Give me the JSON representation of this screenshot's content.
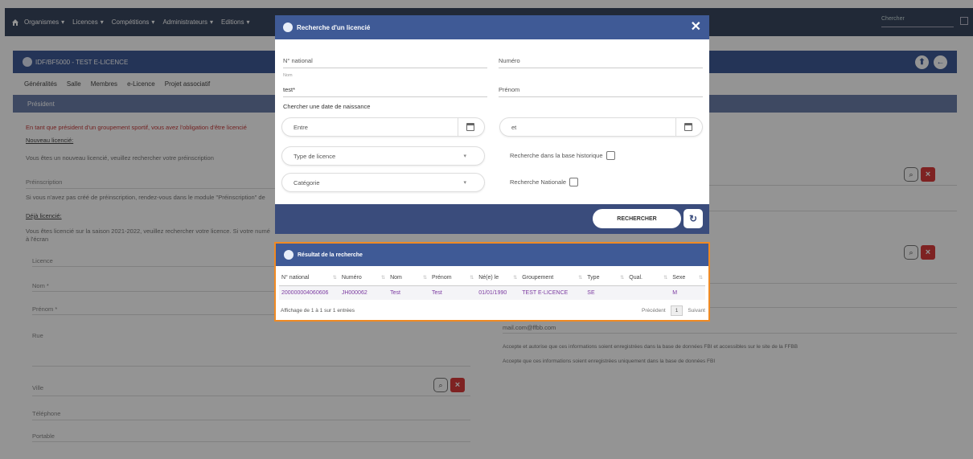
{
  "topnav": {
    "items": [
      "Organismes",
      "Licences",
      "Compétitions",
      "Administrateurs",
      "Editions"
    ],
    "search_placeholder": "Chercher"
  },
  "entity": {
    "title": "IDF/BF5000 - TEST E-LICENCE"
  },
  "tabs": [
    "Généralités",
    "Salle",
    "Membres",
    "e-Licence",
    "Projet associatif"
  ],
  "section": {
    "title": "Président"
  },
  "background": {
    "notice": "En tant que président d'un groupement sportif, vous avez l'obligation d'être licencié",
    "new_licensee_title": "Nouveau licencié:",
    "new_licensee_text": "Vous êtes un nouveau licencié, veuillez rechercher votre préinscription",
    "preinscription_label": "Préinscription",
    "preinscription_help": "Si vous n'avez pas créé de préinscription, rendez-vous dans le module \"Préinscription\" de",
    "already_title": "Déjà licencié:",
    "already_text": "Vous êtes licencié sur la saison 2021-2022, veuillez rechercher votre licence. Si votre numé",
    "already_text2": "à l'écran",
    "licence_label": "Licence",
    "nom_label": "Nom *",
    "prenom_label": "Prénom *",
    "rue_label": "Rue",
    "ville_label": "Ville",
    "telephone_label": "Téléphone",
    "portable_label": "Portable",
    "email_value": "mail.com@ffbb.com",
    "consent_1": "Accepte et autorise que ces informations soient enregistrées dans la base de données FBI et accessibles sur le site de la FFBB",
    "consent_2": "Accepte que ces informations soient enregistrées uniquement dans la base de données FBI"
  },
  "modal": {
    "title": "Recherche d'un licencié",
    "national_label": "N° national",
    "numero_label": "Numéro",
    "nom_small_label": "Nom",
    "nom_value": "test*",
    "prenom_label": "Prénom",
    "birth_title": "Chercher une date de naissance",
    "between_placeholder": "Entre",
    "and_placeholder": "et",
    "licence_type_placeholder": "Type de licence",
    "category_placeholder": "Catégorie",
    "historic_label": "Recherche dans la base historique",
    "national_search_label": "Recherche Nationale",
    "search_button": "RECHERCHER"
  },
  "results": {
    "title": "Résultat de la recherche",
    "columns": [
      "N° national",
      "Numéro",
      "Nom",
      "Prénom",
      "Né(e) le",
      "Groupement",
      "Type",
      "Qual.",
      "Sexe"
    ],
    "rows": [
      [
        "200000004060606",
        "JH000062",
        "Test",
        "Test",
        "01/01/1990",
        "TEST E-LICENCE",
        "SE",
        "",
        "M"
      ]
    ],
    "info": "Affichage de 1 à 1 sur 1 entrées",
    "prev_label": "Précédent",
    "page": "1",
    "next_label": "Suivant"
  },
  "colors": {
    "header_blue": "#3f5a96",
    "footer_blue": "#3a4c7c",
    "highlight_orange": "#f08a23",
    "delete_red": "#d93b3b",
    "link_purple": "#7b3aa0"
  }
}
